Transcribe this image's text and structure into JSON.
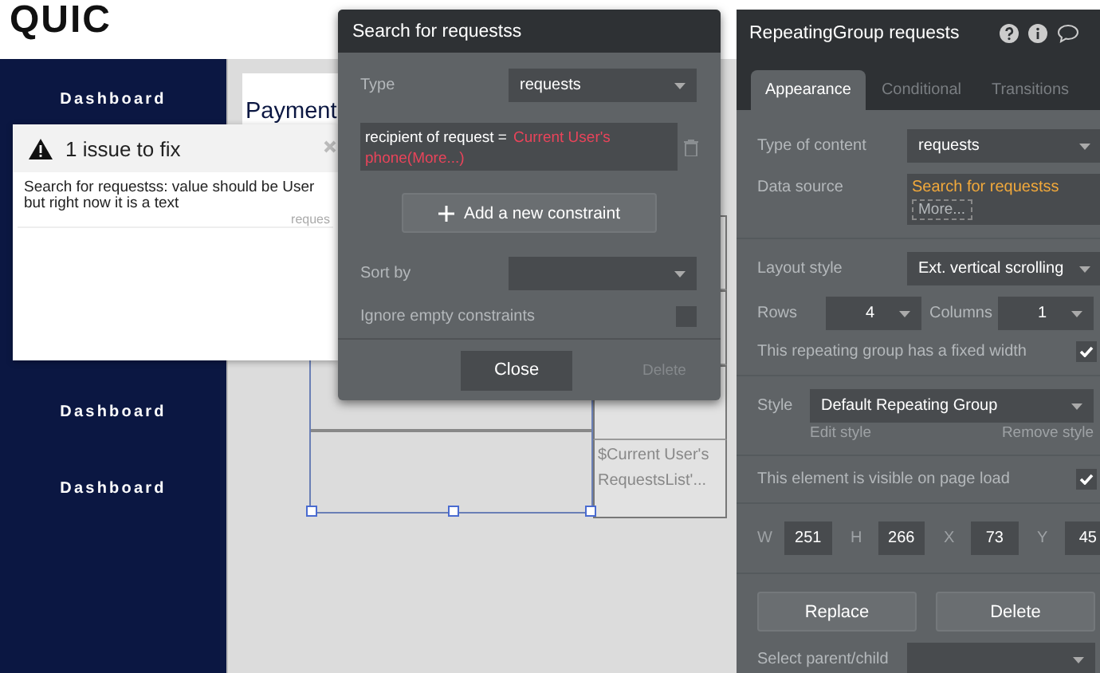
{
  "page": {
    "logo": "QUIC",
    "nav_items": [
      "Dashboard",
      "Dashboard",
      "Dashboard"
    ],
    "card_title": "Payment",
    "cells": [
      {
        "line_1": "$Current User's",
        "line_2": "RequestsList'..."
      }
    ]
  },
  "issues_popup": {
    "title": "1 issue to fix",
    "message": "Search for requestss: value should be User but right now it is a text",
    "source": "reques"
  },
  "search_dialog": {
    "title": "Search for requestss",
    "type_label": "Type",
    "type_value": "requests",
    "constraint": {
      "field": "recipient of request =",
      "value": "Current User's phone(More...)"
    },
    "add_button": "Add a new constraint",
    "sort_label": "Sort by",
    "ignore_label": "Ignore empty constraints",
    "ignore_checked": false,
    "close_button": "Close",
    "delete_button": "Delete"
  },
  "property_panel": {
    "title": "RepeatingGroup requests",
    "tabs": [
      {
        "label": "Appearance",
        "selected": true
      },
      {
        "label": "Conditional",
        "selected": false
      },
      {
        "label": "Transitions",
        "selected": false
      }
    ],
    "type_of_content": {
      "label": "Type of content",
      "value": "requests"
    },
    "data_source": {
      "label": "Data source",
      "value": "Search for requestss",
      "more": "More..."
    },
    "layout_style": {
      "label": "Layout style",
      "value": "Ext. vertical scrolling"
    },
    "rows": {
      "label": "Rows",
      "value": "4"
    },
    "columns": {
      "label": "Columns",
      "value": "1"
    },
    "fixed_width": {
      "label": "This repeating group has a fixed width",
      "checked": true
    },
    "style": {
      "label": "Style",
      "value": "Default Repeating Group",
      "edit": "Edit style",
      "remove": "Remove style"
    },
    "visible": {
      "label": "This element is visible on page load",
      "checked": true
    },
    "geometry": [
      {
        "label": "W",
        "value": "251"
      },
      {
        "label": "H",
        "value": "266"
      },
      {
        "label": "X",
        "value": "73"
      },
      {
        "label": "Y",
        "value": "45"
      }
    ],
    "buttons": [
      "Replace",
      "Delete"
    ],
    "select_parent": {
      "label": "Select parent/child"
    }
  }
}
